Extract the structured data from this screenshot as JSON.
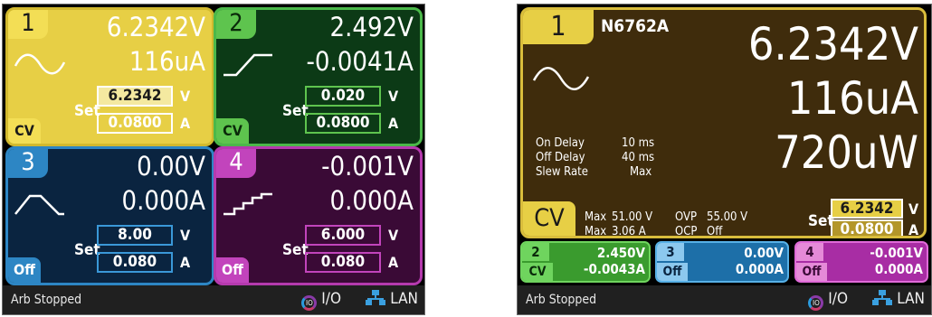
{
  "quad": {
    "channels": [
      {
        "num": "1",
        "voltage": "6.2342V",
        "current": "116uA",
        "set_label": "Set",
        "set_v": "6.2342",
        "set_a": "0.0800",
        "unit_v": "V",
        "unit_a": "A",
        "mode": "CV",
        "wave": "sine"
      },
      {
        "num": "2",
        "voltage": "2.492V",
        "current": "-0.0041A",
        "set_label": "Set",
        "set_v": "0.020",
        "set_a": "0.0800",
        "unit_v": "V",
        "unit_a": "A",
        "mode": "CV",
        "wave": "ramp"
      },
      {
        "num": "3",
        "voltage": "0.00V",
        "current": "0.000A",
        "set_label": "Set",
        "set_v": "8.00",
        "set_a": "0.080",
        "unit_v": "V",
        "unit_a": "A",
        "mode": "Off",
        "wave": "trapezoid"
      },
      {
        "num": "4",
        "voltage": "-0.001V",
        "current": "0.000A",
        "set_label": "Set",
        "set_v": "6.000",
        "set_a": "0.080",
        "unit_v": "V",
        "unit_a": "A",
        "mode": "Off",
        "wave": "staircase"
      }
    ],
    "status": {
      "text": "Arb Stopped",
      "io": "I/O",
      "io_badge": "IO",
      "lan": "LAN"
    }
  },
  "single": {
    "num": "1",
    "model": "N6762A",
    "voltage": "6.2342V",
    "current": "116uA",
    "power": "720uW",
    "params": [
      {
        "label": "On Delay",
        "value": "10 ms"
      },
      {
        "label": "Off Delay",
        "value": "40 ms"
      },
      {
        "label": "Slew Rate",
        "value": "Max"
      }
    ],
    "limits": [
      {
        "a": "Max",
        "b": "51.00 V",
        "c": "OVP",
        "d": "55.00 V"
      },
      {
        "a": "Max",
        "b": "3.06 A",
        "c": "OCP",
        "d": "Off"
      }
    ],
    "mode": "CV",
    "set_label": "Set",
    "set_v": "6.2342",
    "set_a": "0.0800",
    "unit_v": "V",
    "unit_a": "A",
    "minis": [
      {
        "num": "2",
        "mode": "CV",
        "v": "2.450V",
        "a": "-0.0043A"
      },
      {
        "num": "3",
        "mode": "Off",
        "v": "0.00V",
        "a": "0.000A"
      },
      {
        "num": "4",
        "mode": "Off",
        "v": "-0.001V",
        "a": "0.000A"
      }
    ],
    "status": {
      "text": "Arb Stopped",
      "io": "I/O",
      "io_badge": "IO",
      "lan": "LAN"
    }
  },
  "icons": {
    "sine": "sine-wave-icon",
    "ramp": "ramp-wave-icon",
    "trapezoid": "trapezoid-wave-icon",
    "staircase": "staircase-wave-icon",
    "io": "io-icon",
    "lan": "lan-icon"
  }
}
